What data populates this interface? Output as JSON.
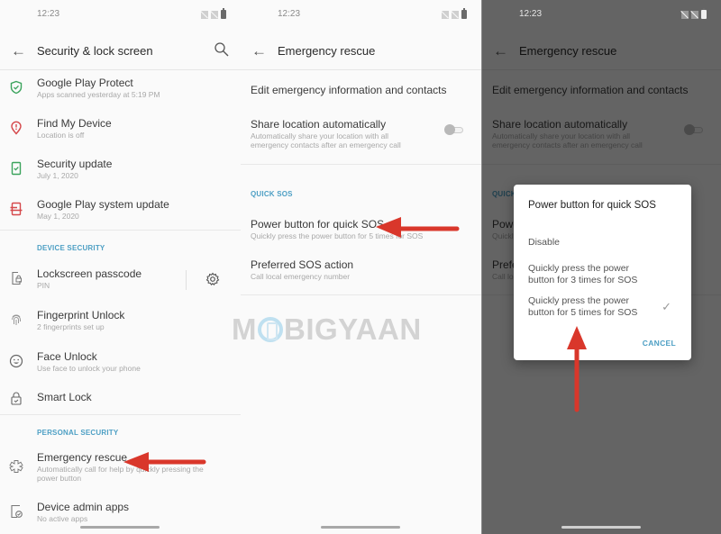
{
  "status_bar": {
    "time": "12:23"
  },
  "panel1": {
    "title": "Security & lock screen",
    "items": [
      {
        "title": "Google Play Protect",
        "subtitle": "Apps scanned yesterday at 5:19 PM",
        "icon": "shield-check-icon"
      },
      {
        "title": "Find My Device",
        "subtitle": "Location is off",
        "icon": "location-pin-icon"
      },
      {
        "title": "Security update",
        "subtitle": "July 1, 2020",
        "icon": "phone-check-icon"
      },
      {
        "title": "Google Play system update",
        "subtitle": "May 1, 2020",
        "icon": "phone-sync-icon"
      }
    ],
    "device_security_header": "DEVICE SECURITY",
    "device_security_items": [
      {
        "title": "Lockscreen passcode",
        "subtitle": "PIN",
        "icon": "lock-phone-icon"
      },
      {
        "title": "Fingerprint Unlock",
        "subtitle": "2 fingerprints set up",
        "icon": "fingerprint-icon"
      },
      {
        "title": "Face Unlock",
        "subtitle": "Use face to unlock your phone",
        "icon": "face-icon"
      },
      {
        "title": "Smart Lock",
        "subtitle": "",
        "icon": "smart-lock-icon"
      }
    ],
    "personal_security_header": "PERSONAL SECURITY",
    "personal_security_items": [
      {
        "title": "Emergency rescue",
        "subtitle": "Automatically call for help by quickly pressing the",
        "subtitle2": "power button",
        "icon": "emergency-icon"
      },
      {
        "title": "Device admin apps",
        "subtitle": "No active apps",
        "icon": "device-admin-icon"
      }
    ]
  },
  "panel2": {
    "title": "Emergency rescue",
    "edit_contacts": "Edit emergency information and contacts",
    "share_location": {
      "title": "Share location automatically",
      "subtitle": "Automatically share your location with all",
      "subtitle2": "emergency contacts after an emergency call",
      "enabled": false
    },
    "quick_sos_header": "QUICK SOS",
    "power_button": {
      "title": "Power button for quick SOS",
      "subtitle": "Quickly press the power button for 5 times for SOS"
    },
    "preferred_action": {
      "title": "Preferred SOS action",
      "subtitle": "Call local emergency number"
    }
  },
  "watermark": {
    "pre": "M",
    "post": "BIGYAAN"
  },
  "dialog": {
    "title": "Power button for quick SOS",
    "options": [
      {
        "label": "Disable",
        "selected": false
      },
      {
        "label": "Quickly press the power button for 3 times for SOS",
        "line1": "Quickly press the power",
        "line2": "button for 3 times for SOS",
        "selected": false
      },
      {
        "label": "Quickly press the power button for 5 times for SOS",
        "line1": "Quickly press the power",
        "line2": "button for 5 times for SOS",
        "selected": true
      }
    ],
    "cancel": "CANCEL",
    "check_glyph": "✓"
  },
  "colors": {
    "accent": "#4d9fc4",
    "arrow": "#d9372b",
    "shield": "#3aa35c",
    "pin": "#d5484b",
    "update": "#3aa35c",
    "sync": "#d5484b"
  }
}
